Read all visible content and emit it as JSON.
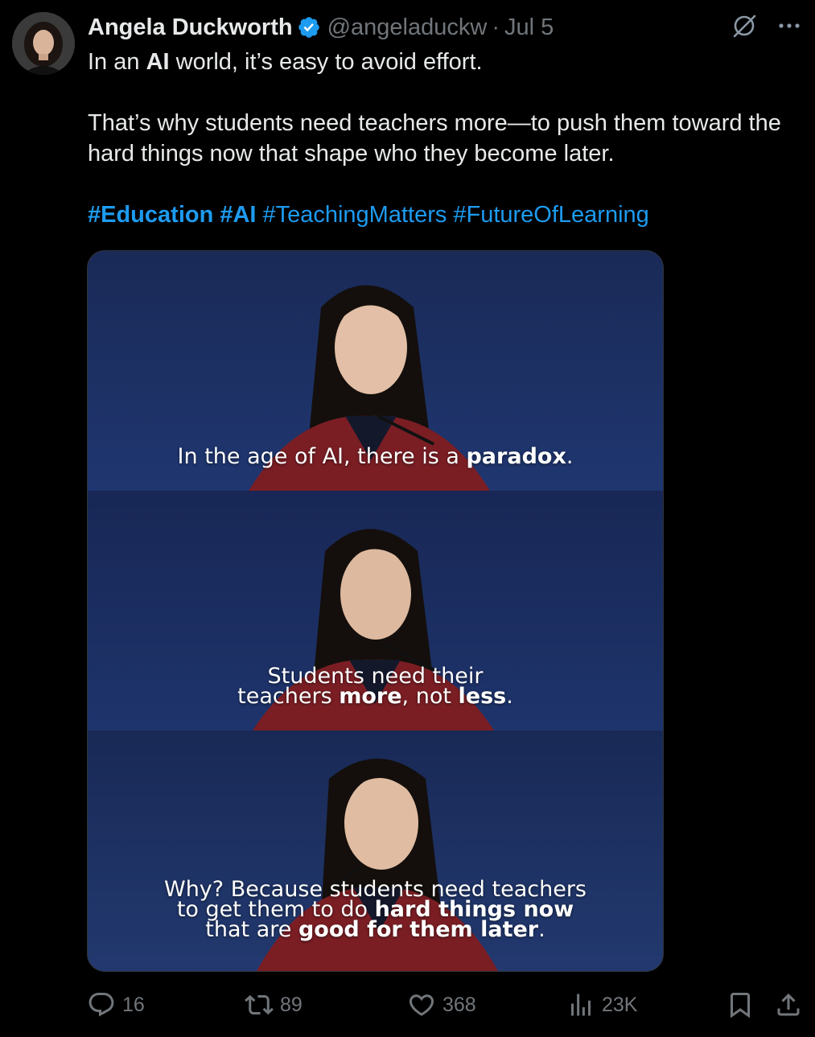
{
  "author": {
    "display_name": "Angela Duckworth",
    "handle": "@angeladuckw",
    "separator": "·",
    "date": "Jul 5",
    "verified_icon": "verified-badge-icon",
    "verified_color": "#1d9bf0"
  },
  "tweet": {
    "line1_pre": "In an ",
    "line1_bold": "AI",
    "line1_post": " world, it’s easy to avoid effort.",
    "line2": "That’s why students need teachers more—to push them toward the hard things now that shape who they become later.",
    "hashtags": [
      "#Education",
      "#AI",
      "#TeachingMatters",
      "#FutureOfLearning"
    ],
    "link_color": "#1d9bf0"
  },
  "media": {
    "frames": [
      {
        "caption_pre": "In the age of AI, there is a ",
        "caption_bold": "paradox",
        "caption_post": "."
      },
      {
        "caption_l1": "Students need their",
        "caption_l2_a": "teachers ",
        "caption_l2_b": "more",
        "caption_l2_c": ", not ",
        "caption_l2_d": "less",
        "caption_l2_e": "."
      },
      {
        "caption_l1": "Why? Because students need teachers",
        "caption_l2_a": "to get them to do ",
        "caption_l2_b": "hard things now",
        "caption_l3_a": "that are ",
        "caption_l3_b": "good for them later",
        "caption_l3_c": "."
      }
    ]
  },
  "actions": {
    "replies": "16",
    "reposts": "89",
    "likes": "368",
    "views": "23K"
  },
  "icons": [
    "grok-icon",
    "more-icon",
    "reply-icon",
    "repost-icon",
    "like-icon",
    "views-icon",
    "bookmark-icon",
    "share-icon"
  ],
  "colors": {
    "background": "#000000",
    "text": "#e7e9ea",
    "muted": "#71767b",
    "accent": "#1d9bf0"
  }
}
